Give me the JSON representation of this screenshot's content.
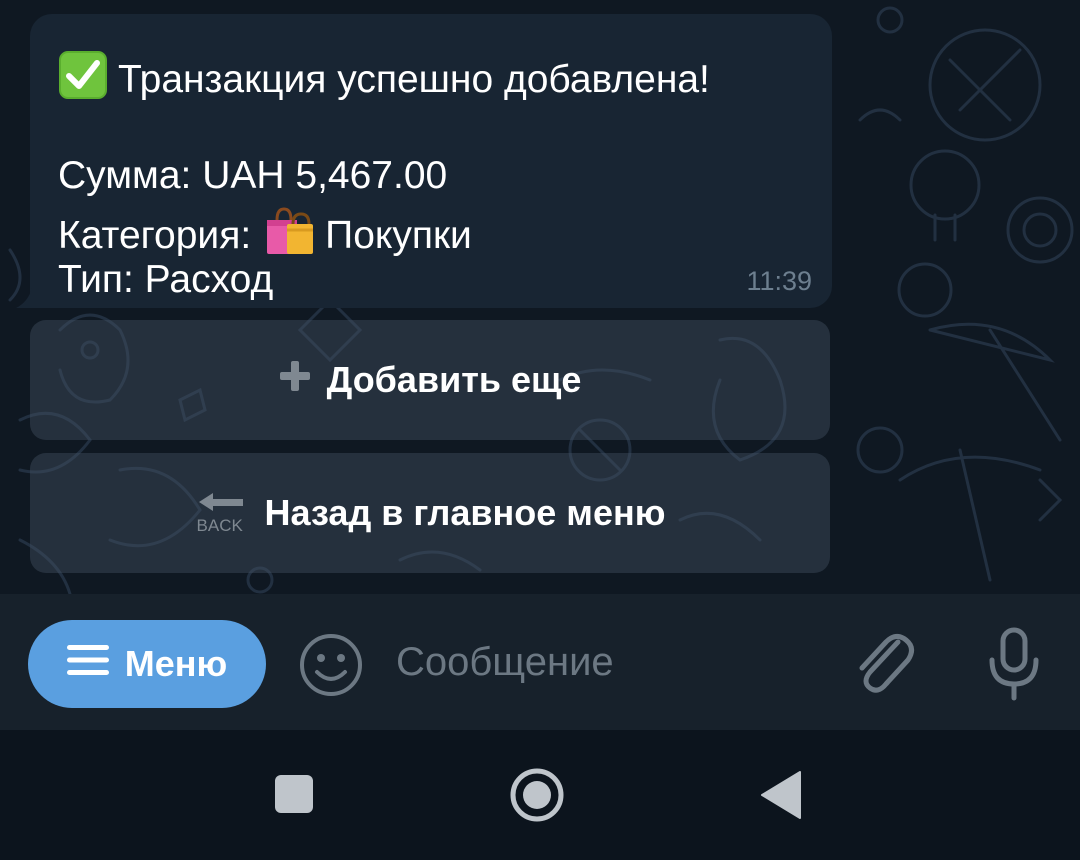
{
  "message": {
    "title_emoji": "white-check-mark-icon",
    "title": "Транзакция успешно добавлена!",
    "amount_line": "Сумма: UAH 5,467.00",
    "category_prefix": "Категория:",
    "category_emoji": "shopping-bags-icon",
    "category_name": "Покупки",
    "type_line": "Тип: Расход",
    "time": "11:39"
  },
  "keyboard": {
    "buttons": [
      {
        "icon": "plus-icon",
        "label": "Добавить еще"
      },
      {
        "icon": "back-arrow-icon",
        "icon_text": "BACK",
        "label": "Назад в главное меню"
      }
    ]
  },
  "input_bar": {
    "menu_label": "Меню",
    "placeholder": "Сообщение"
  },
  "colors": {
    "background": "#0f1822",
    "bubble": "#182533",
    "menu_button": "#5a9fe0",
    "input_bar": "#17212b",
    "accent_text": "#6c7883"
  }
}
